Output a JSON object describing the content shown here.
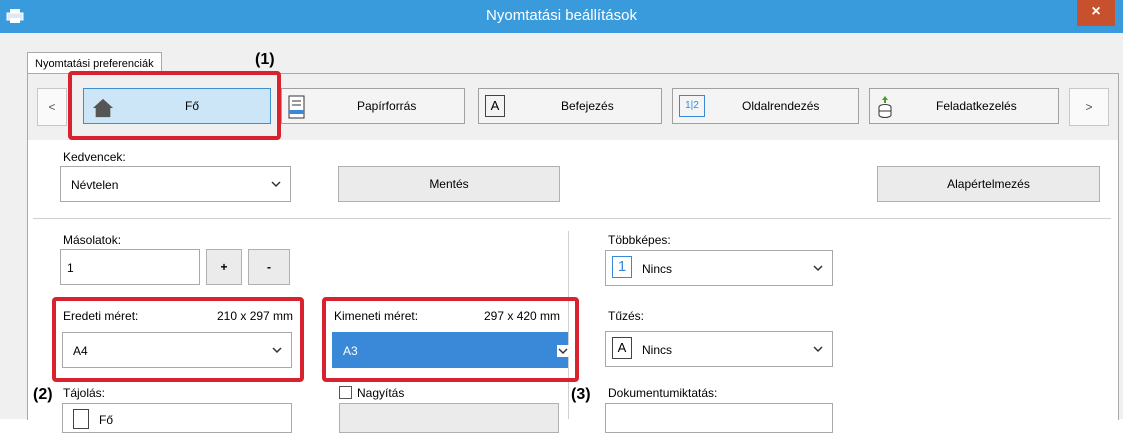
{
  "window": {
    "title": "Nyomtatási beállítások",
    "close": "×"
  },
  "tab": {
    "label": "Nyomtatási preferenciák"
  },
  "toolbar": {
    "prev": "<",
    "next": ">",
    "items": [
      {
        "label": "Fő"
      },
      {
        "label": "Papírforrás"
      },
      {
        "label": "Befejezés",
        "icon_text": "A"
      },
      {
        "label": "Oldalrendezés",
        "icon_text": "1|2"
      },
      {
        "label": "Feladatkezelés"
      }
    ]
  },
  "callouts": {
    "c1": "(1)",
    "c2": "(2)",
    "c3": "(3)"
  },
  "favorites": {
    "label": "Kedvencek:",
    "value": "Névtelen",
    "save": "Mentés",
    "defaults": "Alapértelmezés"
  },
  "copies": {
    "label": "Másolatok:",
    "value": "1",
    "plus": "+",
    "minus": "-"
  },
  "multipage": {
    "label": "Többképes:",
    "icon_text": "1",
    "value": "Nincs"
  },
  "original_size": {
    "label": "Eredeti méret:",
    "dims": "210 x 297 mm",
    "value": "A4"
  },
  "output_size": {
    "label": "Kimeneti méret:",
    "dims": "297 x 420 mm",
    "value": "A3"
  },
  "stapling": {
    "label": "Tűzés:",
    "icon_text": "A",
    "value": "Nincs"
  },
  "orientation": {
    "label": "Tájolás:",
    "value": "Fő"
  },
  "zoom": {
    "label": "Nagyítás"
  },
  "document_filing": {
    "label": "Dokumentumiktatás:"
  },
  "colors": {
    "titlebar": "#3a9bdc",
    "highlight": "#3a88d8",
    "callout_border": "#d8222e"
  },
  "icons": [
    "printer-icon",
    "close-icon",
    "home-icon",
    "paper-tray-icon",
    "finishing-icon",
    "layout-icon",
    "job-storage-icon",
    "chevron-down-icon"
  ]
}
